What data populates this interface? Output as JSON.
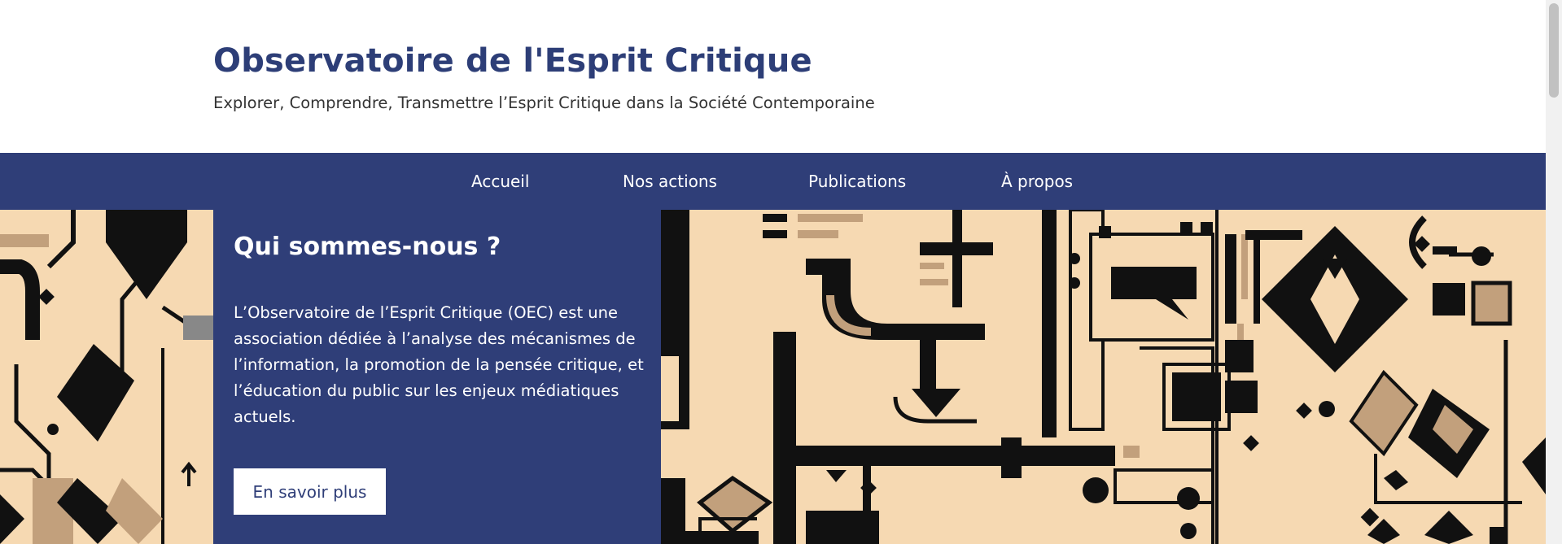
{
  "site": {
    "title": "Observatoire de l'Esprit Critique",
    "tagline": "Explorer, Comprendre, Transmettre l’Esprit Critique dans la Société Contemporaine"
  },
  "nav": {
    "items": [
      {
        "label": "Accueil"
      },
      {
        "label": "Nos actions"
      },
      {
        "label": "Publications"
      },
      {
        "label": "À propos"
      }
    ]
  },
  "hero": {
    "heading": "Qui sommes-nous ?",
    "body": "L’Observatoire de l’Esprit Critique (OEC) est une association dédiée à l’analyse des mécanismes de l’information, la promotion de la pensée critique, et l’éducation du public sur les enjeux médiatiques actuels.",
    "button_label": "En savoir plus"
  },
  "colors": {
    "brand_navy": "#2f3e78",
    "hero_background": "#f6d9b2",
    "pattern_dark": "#111111",
    "pattern_tan": "#c2a07c"
  }
}
